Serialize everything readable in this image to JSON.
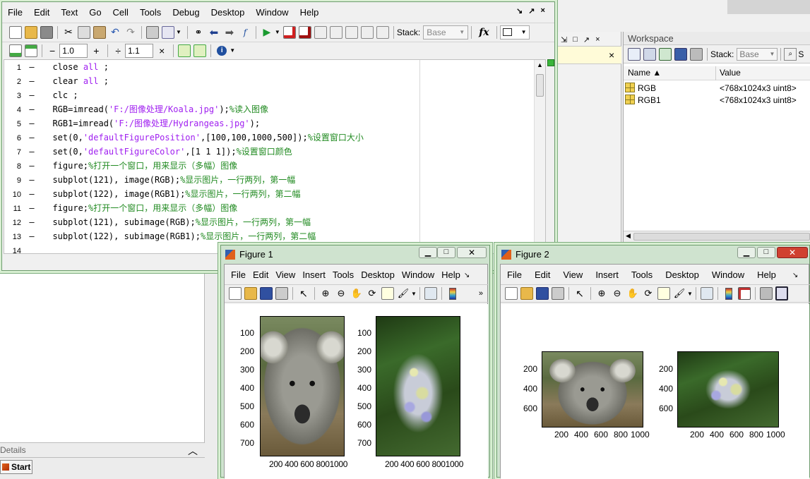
{
  "editor": {
    "menu": [
      "File",
      "Edit",
      "Text",
      "Go",
      "Cell",
      "Tools",
      "Debug",
      "Desktop",
      "Window",
      "Help"
    ],
    "window_controls": [
      "↘",
      "↗",
      "×"
    ],
    "stack_label": "Stack:",
    "stack_value": "Base",
    "fx_label": "fx",
    "cell_decrement": "−",
    "cell_value_1": "1.0",
    "cell_increment": "+",
    "cell_divide": "÷",
    "cell_value_2": "1.1",
    "cell_times": "×",
    "lines": [
      {
        "n": "1",
        "seg": [
          {
            "t": "close ",
            "c": ""
          },
          {
            "t": "all",
            "c": "str"
          },
          {
            "t": " ;",
            "c": ""
          }
        ]
      },
      {
        "n": "2",
        "seg": [
          {
            "t": "clear ",
            "c": ""
          },
          {
            "t": "all",
            "c": "str"
          },
          {
            "t": " ;",
            "c": ""
          }
        ]
      },
      {
        "n": "3",
        "seg": [
          {
            "t": "clc ;",
            "c": ""
          }
        ]
      },
      {
        "n": "4",
        "seg": [
          {
            "t": "RGB=imread(",
            "c": ""
          },
          {
            "t": "'F:/图像处理/Koala.jpg'",
            "c": "str"
          },
          {
            "t": ");",
            "c": ""
          },
          {
            "t": "%读入图像",
            "c": "cmt"
          }
        ]
      },
      {
        "n": "5",
        "seg": [
          {
            "t": "RGB1=imread(",
            "c": ""
          },
          {
            "t": "'F:/图像处理/Hydrangeas.jpg'",
            "c": "str"
          },
          {
            "t": ");",
            "c": ""
          }
        ]
      },
      {
        "n": "6",
        "seg": [
          {
            "t": "set(0,",
            "c": ""
          },
          {
            "t": "'defaultFigurePosition'",
            "c": "str"
          },
          {
            "t": ",[100,100,1000,500]);",
            "c": ""
          },
          {
            "t": "%设置窗口大小",
            "c": "cmt"
          }
        ]
      },
      {
        "n": "7",
        "seg": [
          {
            "t": "set(0,",
            "c": ""
          },
          {
            "t": "'defaultFigureColor'",
            "c": "str"
          },
          {
            "t": ",[1 1 1]);",
            "c": ""
          },
          {
            "t": "%设置窗口颜色",
            "c": "cmt"
          }
        ]
      },
      {
        "n": "8",
        "seg": [
          {
            "t": "figure;",
            "c": ""
          },
          {
            "t": "%打开一个窗口，用来显示（多幅）图像",
            "c": "cmt"
          }
        ]
      },
      {
        "n": "9",
        "seg": [
          {
            "t": "subplot(121), image(RGB);",
            "c": ""
          },
          {
            "t": "%显示图片，一行两列，第一幅",
            "c": "cmt"
          }
        ]
      },
      {
        "n": "10",
        "seg": [
          {
            "t": "subplot(122), image(RGB1);",
            "c": ""
          },
          {
            "t": "%显示图片，一行两列，第二幅",
            "c": "cmt"
          }
        ]
      },
      {
        "n": "11",
        "seg": [
          {
            "t": "figure;",
            "c": ""
          },
          {
            "t": "%打开一个窗口，用来显示（多幅）图像",
            "c": "cmt"
          }
        ]
      },
      {
        "n": "12",
        "seg": [
          {
            "t": "subplot(121), subimage(RGB);",
            "c": ""
          },
          {
            "t": "%显示图片，一行两列，第一幅",
            "c": "cmt"
          }
        ]
      },
      {
        "n": "13",
        "seg": [
          {
            "t": "subplot(122), subimage(RGB1);",
            "c": ""
          },
          {
            "t": "%显示图片，一行两列，第二幅",
            "c": "cmt"
          }
        ]
      },
      {
        "n": "14",
        "seg": []
      }
    ]
  },
  "workspace": {
    "title": "Workspace",
    "stack_label": "Stack:",
    "stack_value": "Base",
    "col_name": "Name ▲",
    "col_value": "Value",
    "rows": [
      {
        "name": "RGB",
        "value": "<768x1024x3 uint8>"
      },
      {
        "name": "RGB1",
        "value": "<768x1024x3 uint8>"
      }
    ],
    "overflow_label": "S"
  },
  "left_panel": {
    "details_label": "Details",
    "start_label": "Start"
  },
  "figure1": {
    "title": "Figure 1",
    "menu": [
      "File",
      "Edit",
      "View",
      "Insert",
      "Tools",
      "Desktop",
      "Window",
      "Help"
    ],
    "y_ticks": [
      "100",
      "200",
      "300",
      "400",
      "500",
      "600",
      "700"
    ],
    "x_ticks_combined": "200 400 600 8001000"
  },
  "figure2": {
    "title": "Figure 2",
    "menu": [
      "File",
      "Edit",
      "View",
      "Insert",
      "Tools",
      "Desktop",
      "Window",
      "Help"
    ],
    "y_ticks": [
      "200",
      "400",
      "600"
    ],
    "x_ticks": [
      "200",
      "400",
      "600",
      "800",
      "1000"
    ]
  },
  "colors": {
    "keyword": "#0000ff",
    "string": "#a020f0",
    "comment": "#228b22",
    "window_border": "#7fae7f"
  }
}
